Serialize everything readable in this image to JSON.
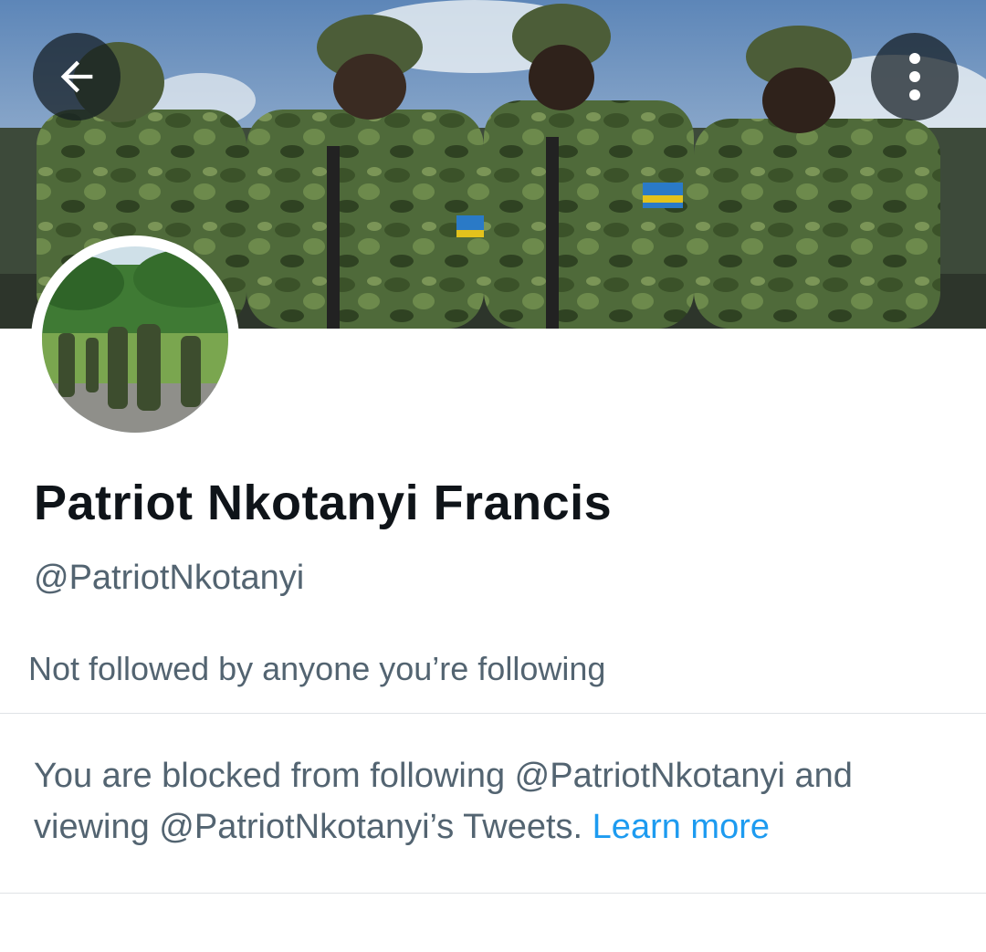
{
  "header": {
    "back_icon": "arrow-left-icon",
    "more_icon": "more-vertical-icon"
  },
  "profile": {
    "display_name": "Patriot Nkotanyi Francis",
    "handle": "@PatriotNkotanyi",
    "followers_note": "Not followed by anyone you’re following"
  },
  "blocked": {
    "message": "You are blocked from following @PatriotNkotanyi and viewing @PatriotNkotanyi’s Tweets.",
    "learn_more_label": "Learn more"
  },
  "colors": {
    "primary_text": "#0f1419",
    "secondary_text": "#536471",
    "link": "#1d9bf0",
    "divider": "#dfe3e6"
  }
}
